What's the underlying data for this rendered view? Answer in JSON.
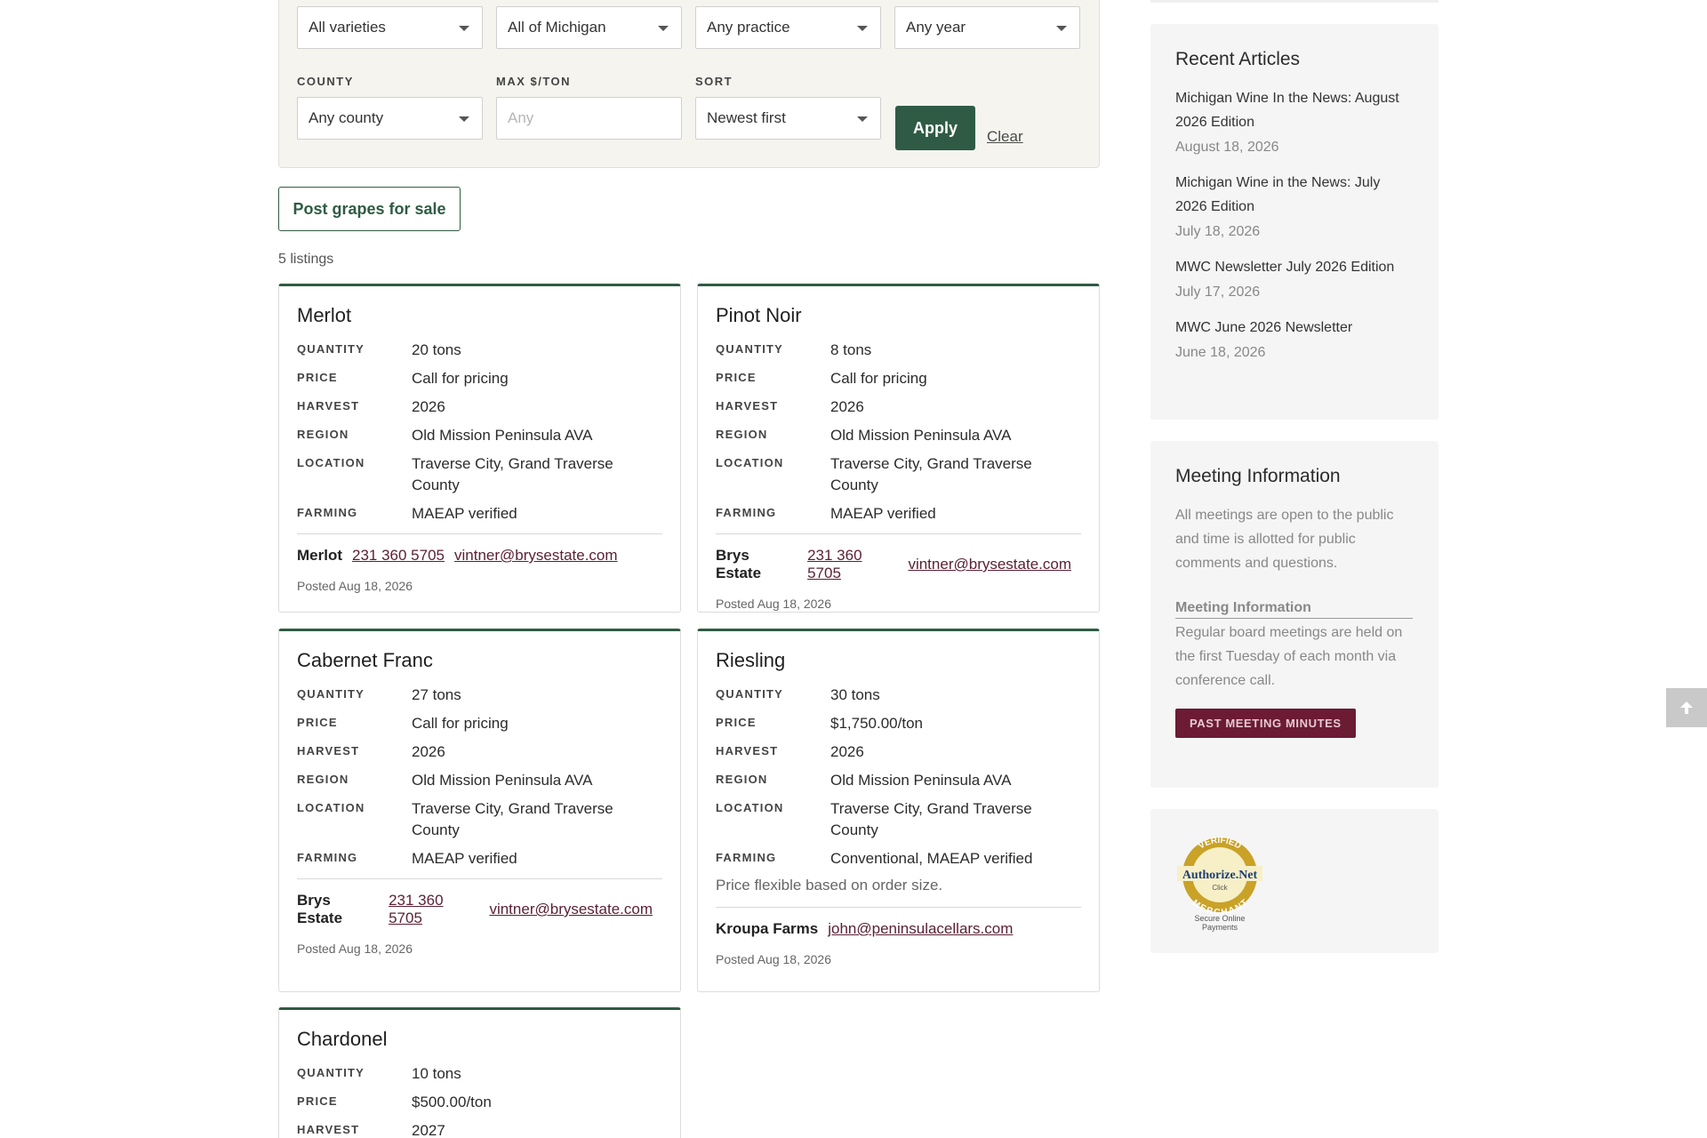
{
  "filters": {
    "variety": "All varieties",
    "region": "All of Michigan",
    "practice": "Any practice",
    "year": "Any year",
    "county_label": "COUNTY",
    "county": "Any county",
    "max_price_label": "MAX $/TON",
    "max_price_placeholder": "Any",
    "sort_label": "SORT",
    "sort": "Newest first",
    "apply_label": "Apply",
    "clear_label": "Clear"
  },
  "post_button": "Post grapes for sale",
  "listing_count": "5 listings",
  "field_labels": {
    "quantity": "QUANTITY",
    "price": "PRICE",
    "harvest": "HARVEST",
    "region": "REGION",
    "location": "LOCATION",
    "farming": "FARMING"
  },
  "listings": [
    {
      "variety": "Merlot",
      "quantity": "20 tons",
      "price": "Call for pricing",
      "harvest": "2026",
      "region": "Old Mission Peninsula AVA",
      "location": "Traverse City, Grand Traverse County",
      "farming": "MAEAP verified",
      "seller": "Merlot",
      "phone": "231 360 5705",
      "email": "vintner@brysestate.com",
      "posted": "Posted Aug 18, 2026"
    },
    {
      "variety": "Pinot Noir",
      "quantity": "8 tons",
      "price": "Call for pricing",
      "harvest": "2026",
      "region": "Old Mission Peninsula AVA",
      "location": "Traverse City, Grand Traverse County",
      "farming": "MAEAP verified",
      "seller": "Brys Estate",
      "phone": "231 360 5705",
      "email": "vintner@brysestate.com",
      "posted": "Posted Aug 18, 2026"
    },
    {
      "variety": "Cabernet Franc",
      "quantity": "27 tons",
      "price": "Call for pricing",
      "harvest": "2026",
      "region": "Old Mission Peninsula AVA",
      "location": "Traverse City, Grand Traverse County",
      "farming": "MAEAP verified",
      "seller": "Brys Estate",
      "phone": "231 360 5705",
      "email": "vintner@brysestate.com",
      "posted": "Posted Aug 18, 2026"
    },
    {
      "variety": "Riesling",
      "quantity": "30 tons",
      "price": "$1,750.00/ton",
      "harvest": "2026",
      "region": "Old Mission Peninsula AVA",
      "location": "Traverse City, Grand Traverse County",
      "farming": "Conventional, MAEAP verified",
      "note": "Price flexible based on order size.",
      "seller": "Kroupa Farms",
      "email": "john@peninsulacellars.com",
      "posted": "Posted Aug 18, 2026"
    },
    {
      "variety": "Chardonel",
      "quantity": "10 tons",
      "price": "$500.00/ton",
      "harvest": "2027"
    }
  ],
  "sidebar": {
    "recent_title": "Recent Articles",
    "articles": [
      {
        "title": "Michigan Wine In the News: August 2026 Edition",
        "date": "August 18, 2026"
      },
      {
        "title": "Michigan Wine in the News: July 2026 Edition",
        "date": "July 18, 2026"
      },
      {
        "title": "MWC Newsletter July 2026 Edition",
        "date": "July 17, 2026"
      },
      {
        "title": "MWC June 2026 Newsletter",
        "date": "June 18, 2026"
      }
    ],
    "meeting_title": "Meeting Information",
    "meeting_text": "All meetings are open to the public and time is allotted for public comments and questions.",
    "meeting_subtitle": "Meeting Information",
    "meeting_detail": "Regular board meetings are held on the first Tuesday of each month via conference call.",
    "minutes_button": "PAST MEETING MINUTES",
    "badge": {
      "ring_top": "VERIFIED",
      "ring_bottom": "MERCHANT",
      "brand": "Authorize.Net",
      "click": "Click",
      "caption1": "Secure Online",
      "caption2": "Payments"
    }
  },
  "colors": {
    "brand_green": "#2f5b44",
    "link_maroon": "#5a2136",
    "minutes_bg": "#6b1b34"
  },
  "icons": {
    "scroll_top": "arrow-up-icon",
    "dropdown": "caret-down-icon"
  }
}
